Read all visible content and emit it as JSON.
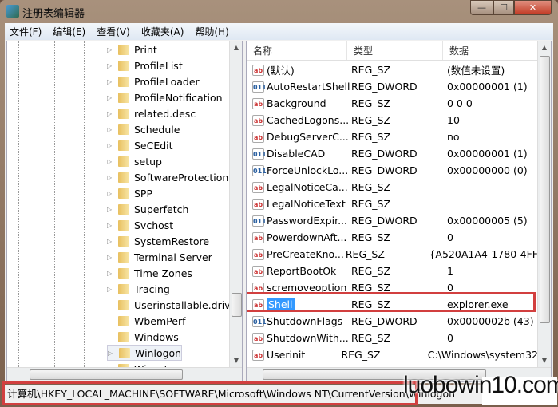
{
  "window": {
    "title": "注册表编辑器",
    "min": "—",
    "max": "☐",
    "close": "✕"
  },
  "menu": [
    "文件(F)",
    "编辑(E)",
    "查看(V)",
    "收藏夹(A)",
    "帮助(H)"
  ],
  "tree": {
    "items": [
      {
        "label": "Print",
        "expander": true
      },
      {
        "label": "ProfileList",
        "expander": true
      },
      {
        "label": "ProfileLoader",
        "expander": true
      },
      {
        "label": "ProfileNotification",
        "expander": true
      },
      {
        "label": "related.desc",
        "expander": true
      },
      {
        "label": "Schedule",
        "expander": true
      },
      {
        "label": "SeCEdit",
        "expander": true
      },
      {
        "label": "setup",
        "expander": true
      },
      {
        "label": "SoftwareProtectionP",
        "expander": true
      },
      {
        "label": "SPP",
        "expander": true
      },
      {
        "label": "Superfetch",
        "expander": true
      },
      {
        "label": "Svchost",
        "expander": true
      },
      {
        "label": "SystemRestore",
        "expander": true
      },
      {
        "label": "Terminal Server",
        "expander": true
      },
      {
        "label": "Time Zones",
        "expander": true
      },
      {
        "label": "Tracing",
        "expander": true
      },
      {
        "label": "Userinstallable.drive",
        "expander": false
      },
      {
        "label": "WbemPerf",
        "expander": false
      },
      {
        "label": "Windows",
        "expander": false
      },
      {
        "label": "Winlogon",
        "expander": true,
        "selected": true
      },
      {
        "label": "Winsat",
        "expander": true
      }
    ]
  },
  "list": {
    "headers": [
      "名称",
      "类型",
      "数据"
    ],
    "rows": [
      {
        "icon": "ab",
        "name": "(默认)",
        "type": "REG_SZ",
        "data": "(数值未设置)"
      },
      {
        "icon": "bin",
        "name": "AutoRestartShell",
        "type": "REG_DWORD",
        "data": "0x00000001 (1)"
      },
      {
        "icon": "ab",
        "name": "Background",
        "type": "REG_SZ",
        "data": "0 0 0"
      },
      {
        "icon": "ab",
        "name": "CachedLogons...",
        "type": "REG_SZ",
        "data": "10"
      },
      {
        "icon": "ab",
        "name": "DebugServerC...",
        "type": "REG_SZ",
        "data": "no"
      },
      {
        "icon": "bin",
        "name": "DisableCAD",
        "type": "REG_DWORD",
        "data": "0x00000001 (1)"
      },
      {
        "icon": "bin",
        "name": "ForceUnlockLo...",
        "type": "REG_DWORD",
        "data": "0x00000000 (0)"
      },
      {
        "icon": "ab",
        "name": "LegalNoticeCa...",
        "type": "REG_SZ",
        "data": ""
      },
      {
        "icon": "ab",
        "name": "LegalNoticeText",
        "type": "REG_SZ",
        "data": ""
      },
      {
        "icon": "bin",
        "name": "PasswordExpir...",
        "type": "REG_DWORD",
        "data": "0x00000005 (5)"
      },
      {
        "icon": "ab",
        "name": "PowerdownAft...",
        "type": "REG_SZ",
        "data": "0"
      },
      {
        "icon": "ab",
        "name": "PreCreateKno...",
        "type": "REG_SZ",
        "data": "{A520A1A4-1780-4FF"
      },
      {
        "icon": "ab",
        "name": "ReportBootOk",
        "type": "REG_SZ",
        "data": "1"
      },
      {
        "icon": "ab",
        "name": "scremoveoption",
        "type": "REG_SZ",
        "data": "0"
      },
      {
        "icon": "ab",
        "name": "Shell",
        "type": "REG_SZ",
        "data": "explorer.exe",
        "selected": true
      },
      {
        "icon": "bin",
        "name": "ShutdownFlags",
        "type": "REG_DWORD",
        "data": "0x0000002b (43)"
      },
      {
        "icon": "ab",
        "name": "ShutdownWith...",
        "type": "REG_SZ",
        "data": "0"
      },
      {
        "icon": "ab",
        "name": "Userinit",
        "type": "REG_SZ",
        "data": "C:\\Windows\\system32"
      }
    ]
  },
  "status": "计算机\\HKEY_LOCAL_MACHINE\\SOFTWARE\\Microsoft\\Windows NT\\CurrentVersion\\Winlogon",
  "watermark": "luobowin10.com",
  "colors": {
    "highlight": "#d23f3f",
    "selection": "#3399ff"
  }
}
